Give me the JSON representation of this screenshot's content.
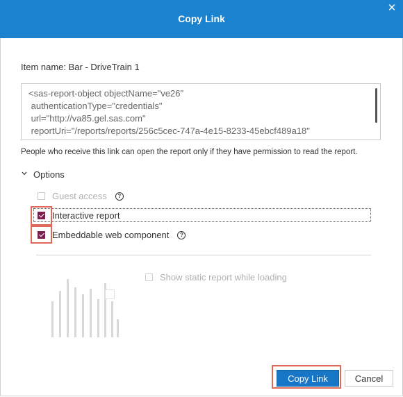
{
  "dialog": {
    "title": "Copy Link",
    "close_icon": "close-icon"
  },
  "item_name": "Item name: Bar - DriveTrain 1",
  "code": {
    "lines": [
      "<sas-report-object objectName=\"ve26\"",
      " authenticationType=\"credentials\"",
      " url=\"http://va85.gel.sas.com\"",
      " reportUri=\"/reports/reports/256c5cec-747a-4e15-8233-45ebcf489a18\""
    ]
  },
  "permission_note": "People who receive this link can open the report only if they have permission to read the report.",
  "options": {
    "header": "Options",
    "guest_access": {
      "label": "Guest access",
      "checked": false,
      "disabled": true
    },
    "interactive_report": {
      "label": "Interactive report",
      "checked": true
    },
    "embeddable_component": {
      "label": "Embeddable web component",
      "checked": true
    },
    "static_report": {
      "label": "Show static report while loading",
      "checked": false,
      "disabled": true
    }
  },
  "buttons": {
    "copy_link": "Copy Link",
    "cancel": "Cancel"
  },
  "colors": {
    "title_bar": "#1a82cf",
    "primary_button": "#1776c6",
    "checkbox_checked": "#7b2150",
    "highlight_box": "#e06a5a"
  }
}
